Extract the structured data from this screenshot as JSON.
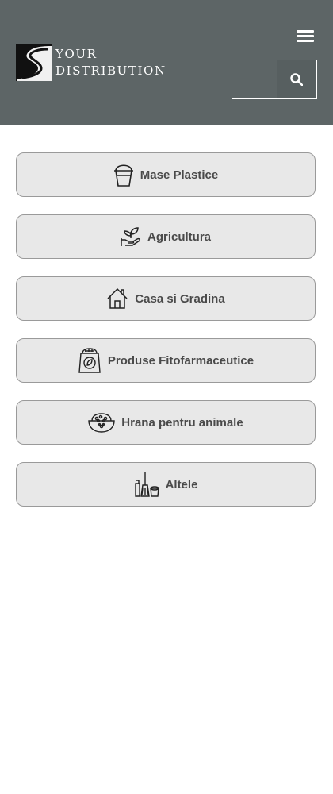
{
  "brand": {
    "line1": "YOUR",
    "line2": "DISTRIBUTION"
  },
  "header": {
    "menu_icon": "hamburger-icon",
    "search": {
      "placeholder": "",
      "value": "",
      "button_icon": "search-icon"
    }
  },
  "colors": {
    "header_bg": "#5d6566",
    "card_bg": "#e8e8e8",
    "card_border": "#9a9a9a",
    "text": "#4a4a4a"
  },
  "categories": [
    {
      "label": "Mase Plastice",
      "icon": "bucket-icon"
    },
    {
      "label": "Agricultura",
      "icon": "plant-hand-icon"
    },
    {
      "label": "Casa si Gradina",
      "icon": "house-icon"
    },
    {
      "label": "Produse Fitofarmaceutice",
      "icon": "fertilizer-bag-icon"
    },
    {
      "label": "Hrana pentru animale",
      "icon": "pet-food-bowl-icon"
    },
    {
      "label": "Altele",
      "icon": "cleaning-supplies-icon"
    }
  ]
}
